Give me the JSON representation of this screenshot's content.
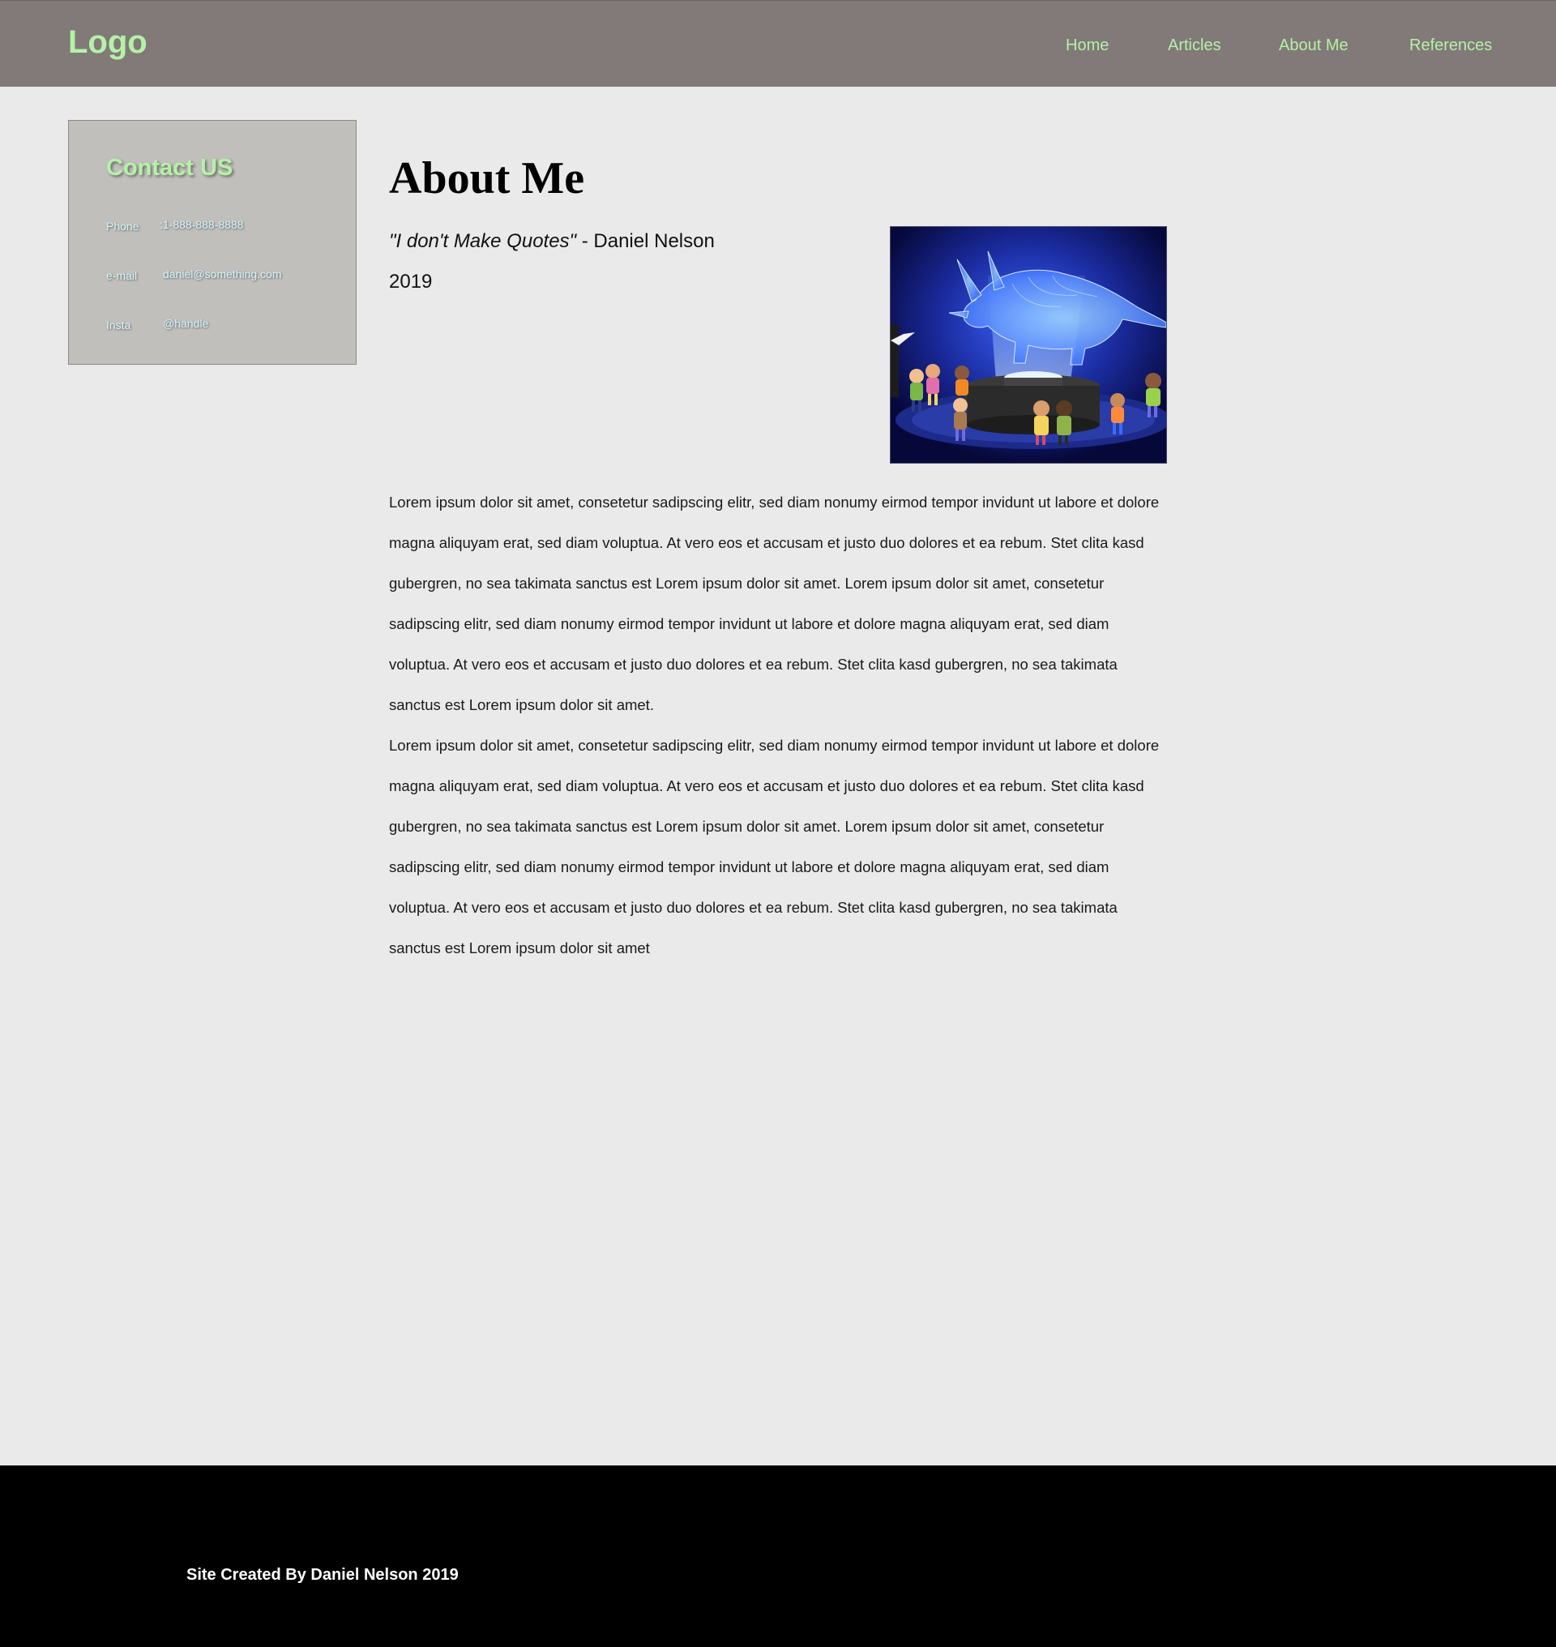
{
  "header": {
    "logo": "Logo",
    "nav": [
      {
        "label": "Home"
      },
      {
        "label": "Articles"
      },
      {
        "label": "About Me"
      },
      {
        "label": "References"
      }
    ]
  },
  "contact": {
    "title": "Contact US",
    "rows": [
      {
        "label": "Phone",
        "value": ":1-888-888-8888"
      },
      {
        "label": "e-mail",
        "value": "daniel@something.com"
      },
      {
        "label": "Insta",
        "value": "@handle"
      }
    ]
  },
  "main": {
    "title": "About Me",
    "quote": "\"I don't Make Quotes\"",
    "quote_attribution": " - Daniel Nelson",
    "year": "2019",
    "paragraphs": [
      "Lorem ipsum dolor sit amet, consetetur sadipscing elitr, sed diam nonumy eirmod tempor invidunt ut labore et dolore magna aliquyam erat, sed diam voluptua. At vero eos et accusam et justo duo dolores et ea rebum. Stet clita kasd gubergren, no sea takimata sanctus est Lorem ipsum dolor sit amet. Lorem ipsum dolor sit amet, consetetur sadipscing elitr, sed diam nonumy eirmod tempor invidunt ut labore et dolore magna aliquyam erat, sed diam voluptua. At vero eos et accusam et justo duo dolores et ea rebum. Stet clita kasd gubergren, no sea takimata sanctus est Lorem ipsum dolor sit amet.",
      "Lorem ipsum dolor sit amet, consetetur sadipscing elitr, sed diam nonumy eirmod tempor invidunt ut labore et dolore magna aliquyam erat, sed diam voluptua. At vero eos et accusam et justo duo dolores et ea rebum. Stet clita kasd gubergren, no sea takimata sanctus est Lorem ipsum dolor sit amet. Lorem ipsum dolor sit amet, consetetur sadipscing elitr, sed diam nonumy eirmod tempor invidunt ut labore et dolore magna aliquyam erat, sed diam voluptua. At vero eos et accusam et justo duo dolores et ea rebum. Stet clita kasd gubergren, no sea takimata sanctus est Lorem ipsum dolor sit amet"
    ]
  },
  "footer": {
    "text": "Site Created By Daniel Nelson 2019"
  },
  "colors": {
    "header_bg": "#827979",
    "accent_green": "#b4f2a6",
    "page_bg": "#eaeaea",
    "card_bg": "#c0bfbc",
    "contact_text": "#d6f7ff",
    "footer_bg": "#000000"
  }
}
